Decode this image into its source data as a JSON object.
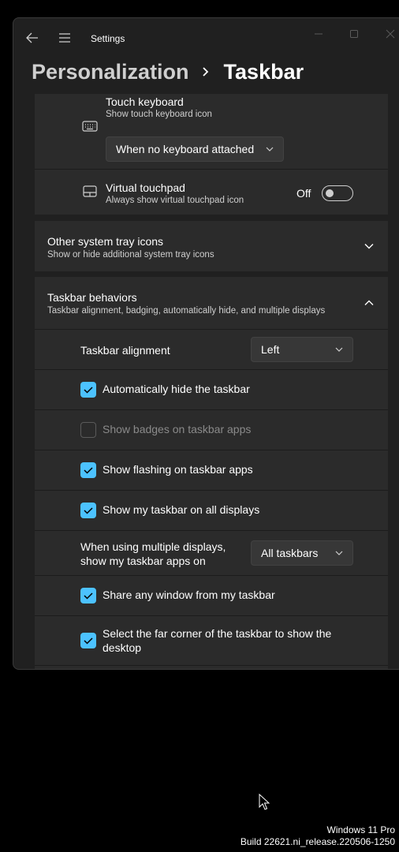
{
  "window": {
    "app_title": "Settings"
  },
  "breadcrumb": {
    "parent": "Personalization",
    "separator": "›",
    "current": "Taskbar"
  },
  "touch_keyboard": {
    "title": "Touch keyboard",
    "subtitle": "Show touch keyboard icon",
    "dropdown_value": "When no keyboard attached"
  },
  "virtual_touchpad": {
    "title": "Virtual touchpad",
    "subtitle": "Always show virtual touchpad icon",
    "toggle_state": "Off"
  },
  "other_tray": {
    "title": "Other system tray icons",
    "subtitle": "Show or hide additional system tray icons"
  },
  "behaviors": {
    "title": "Taskbar behaviors",
    "subtitle": "Taskbar alignment, badging, automatically hide, and multiple displays",
    "alignment_label": "Taskbar alignment",
    "alignment_value": "Left",
    "auto_hide": {
      "label": "Automatically hide the taskbar",
      "checked": true
    },
    "badges": {
      "label": "Show badges on taskbar apps",
      "checked": false,
      "enabled": false
    },
    "flashing": {
      "label": "Show flashing on taskbar apps",
      "checked": true
    },
    "all_displays": {
      "label": "Show my taskbar on all displays",
      "checked": true
    },
    "multi_display_label_1": "When using multiple displays,",
    "multi_display_label_2": "show my taskbar apps on",
    "multi_display_value": "All taskbars",
    "share_window": {
      "label": "Share any window from my taskbar",
      "checked": true
    },
    "far_corner": {
      "label_1": "Select the far corner of the taskbar to show the",
      "label_2": "desktop",
      "checked": true
    }
  },
  "watermark": {
    "edition": "Windows 11 Pro",
    "build": "Build 22621.ni_release.220506-1250"
  },
  "colors": {
    "accent": "#4cc2ff",
    "card": "#2b2b2b",
    "window": "#202020"
  }
}
